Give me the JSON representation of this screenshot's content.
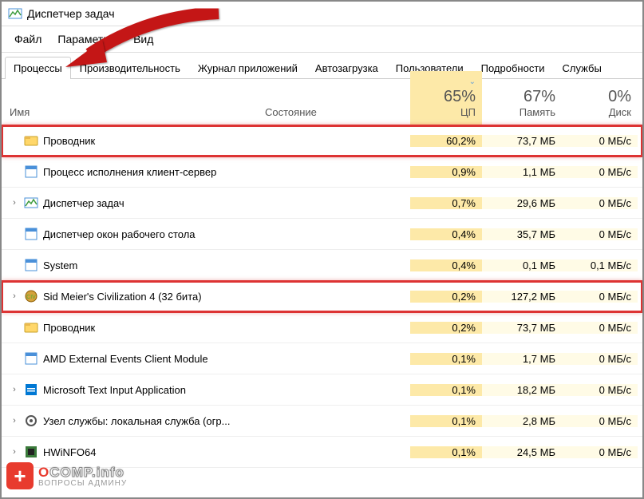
{
  "title": "Диспетчер задач",
  "menu": {
    "file": "Файл",
    "options": "Параметры",
    "view": "Вид"
  },
  "tabs": {
    "processes": "Процессы",
    "performance": "Производительность",
    "app_history": "Журнал приложений",
    "startup": "Автозагрузка",
    "users": "Пользователи",
    "details": "Подробности",
    "services": "Службы"
  },
  "columns": {
    "name": "Имя",
    "status": "Состояние",
    "cpu_pct": "65%",
    "cpu_label": "ЦП",
    "mem_pct": "67%",
    "mem_label": "Память",
    "disk_pct": "0%",
    "disk_label": "Диск"
  },
  "rows": [
    {
      "name": "Проводник",
      "cpu": "60,2%",
      "mem": "73,7 МБ",
      "disk": "0 МБ/с",
      "icon": "explorer",
      "expandable": false,
      "highlighted": true
    },
    {
      "name": "Процесс исполнения клиент-сервер",
      "cpu": "0,9%",
      "mem": "1,1 МБ",
      "disk": "0 МБ/с",
      "icon": "app",
      "expandable": false,
      "highlighted": false
    },
    {
      "name": "Диспетчер задач",
      "cpu": "0,7%",
      "mem": "29,6 МБ",
      "disk": "0 МБ/с",
      "icon": "taskmgr",
      "expandable": true,
      "highlighted": false
    },
    {
      "name": "Диспетчер окон рабочего стола",
      "cpu": "0,4%",
      "mem": "35,7 МБ",
      "disk": "0 МБ/с",
      "icon": "app",
      "expandable": false,
      "highlighted": false
    },
    {
      "name": "System",
      "cpu": "0,4%",
      "mem": "0,1 МБ",
      "disk": "0,1 МБ/с",
      "icon": "app",
      "expandable": false,
      "highlighted": false
    },
    {
      "name": "Sid Meier's Civilization 4 (32 бита)",
      "cpu": "0,2%",
      "mem": "127,2 МБ",
      "disk": "0 МБ/с",
      "icon": "civ",
      "expandable": true,
      "highlighted": true
    },
    {
      "name": "Проводник",
      "cpu": "0,2%",
      "mem": "73,7 МБ",
      "disk": "0 МБ/с",
      "icon": "explorer",
      "expandable": false,
      "highlighted": false
    },
    {
      "name": "AMD External Events Client Module",
      "cpu": "0,1%",
      "mem": "1,7 МБ",
      "disk": "0 МБ/с",
      "icon": "app",
      "expandable": false,
      "highlighted": false
    },
    {
      "name": "Microsoft Text Input Application",
      "cpu": "0,1%",
      "mem": "18,2 МБ",
      "disk": "0 МБ/с",
      "icon": "ms",
      "expandable": true,
      "highlighted": false
    },
    {
      "name": "Узел службы: локальная служба (огр...",
      "cpu": "0,1%",
      "mem": "2,8 МБ",
      "disk": "0 МБ/с",
      "icon": "svc",
      "expandable": true,
      "highlighted": false
    },
    {
      "name": "HWiNFO64",
      "cpu": "0,1%",
      "mem": "24,5 МБ",
      "disk": "0 МБ/с",
      "icon": "hw",
      "expandable": true,
      "highlighted": false
    }
  ],
  "watermark": {
    "brand_o": "O",
    "brand_rest": "COMP.info",
    "sub": "ВОПРОСЫ АДМИНУ"
  }
}
